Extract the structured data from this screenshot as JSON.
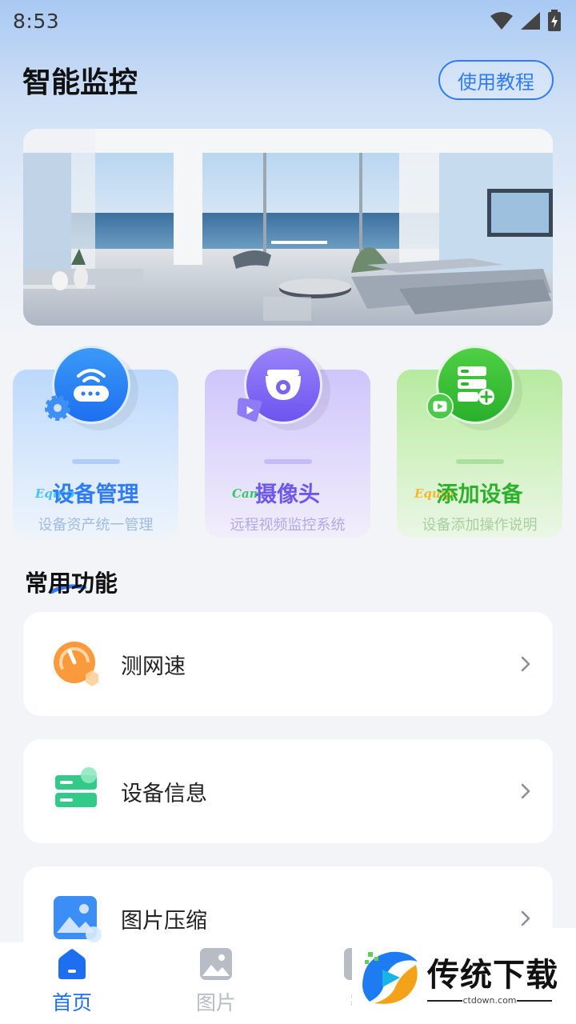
{
  "status_bar": {
    "time": "8:53"
  },
  "header": {
    "title": "智能监控",
    "tutorial_button": "使用教程"
  },
  "cards": [
    {
      "title": "设备管理",
      "subtitle": "设备资产统一管理",
      "deco": "Equip",
      "color": "#2f7cf6"
    },
    {
      "title": "摄像头",
      "subtitle": "远程视频监控系统",
      "deco": "Cam",
      "color": "#6f56ee"
    },
    {
      "title": "添加设备",
      "subtitle": "设备添加操作说明",
      "deco": "Equip",
      "color": "#2db12c"
    }
  ],
  "section": {
    "title": "常用功能"
  },
  "functions": [
    {
      "label": "测网速",
      "icon": "speedometer-icon"
    },
    {
      "label": "设备信息",
      "icon": "server-info-icon"
    },
    {
      "label": "图片压缩",
      "icon": "image-compress-icon"
    }
  ],
  "bottom_nav": [
    {
      "label": "首页",
      "icon": "home-icon",
      "active": true
    },
    {
      "label": "图片",
      "icon": "image-icon",
      "active": false
    },
    {
      "label": "密",
      "icon": "lock-icon",
      "active": false
    }
  ],
  "watermark": {
    "brand": "传统下载",
    "url": "ctdown.com"
  },
  "colors": {
    "accent": "#2f7cf6",
    "background": "#f2f4f8",
    "nav_active": "#1e6ff0",
    "nav_inactive": "#b8bcc4"
  }
}
